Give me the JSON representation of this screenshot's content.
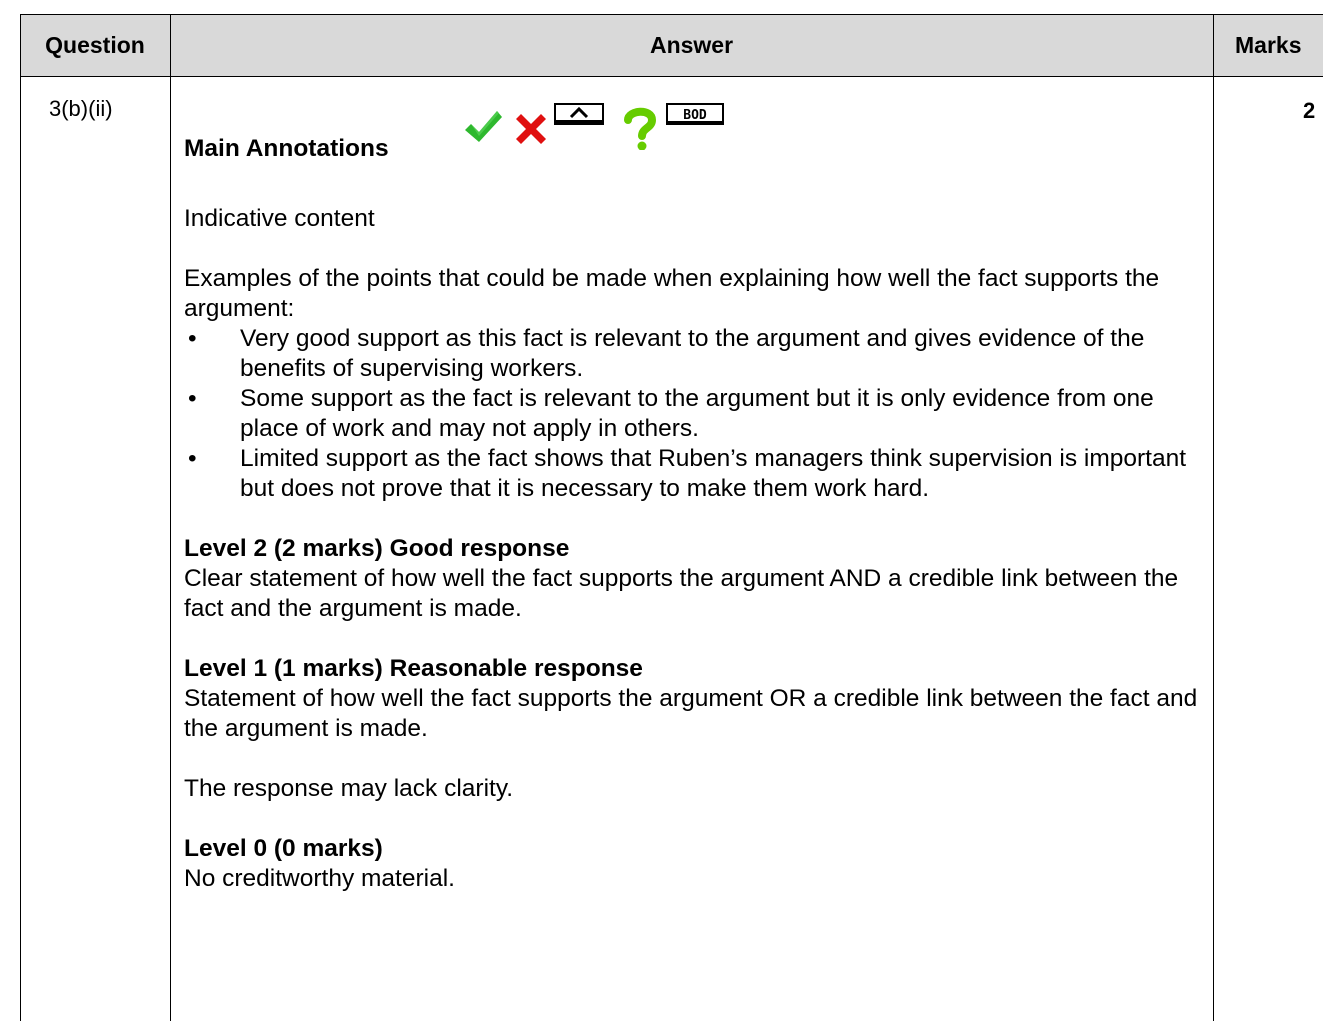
{
  "table": {
    "headers": {
      "question": "Question",
      "answer": "Answer",
      "marks": "Marks"
    },
    "row": {
      "question": "3(b)(ii)",
      "marks": "2"
    }
  },
  "answer": {
    "annotations_label": "Main Annotations",
    "annotation_icons": [
      "tick-icon",
      "cross-icon",
      "caret-icon",
      "question-mark-icon",
      "bod-icon"
    ],
    "annotation_bod_text": "BOD",
    "indicative": "Indicative content",
    "intro": "Examples of the points that could be made when explaining how well the fact supports the argument:",
    "points": [
      "Very good support as this fact is relevant to the argument and gives evidence of the benefits of supervising workers.",
      "Some support as the fact is relevant to the argument but it is only evidence from one place of work and may not apply in others.",
      "Limited support as the fact shows that Ruben’s managers think supervision is important but does not prove that it is necessary to make them work hard."
    ],
    "level2": {
      "heading": "Level 2 (2 marks) Good response",
      "text": "Clear statement of how well the fact supports the argument AND a credible link between the fact and the argument is made."
    },
    "level1": {
      "heading": "Level 1 (1 marks) Reasonable response",
      "text": "Statement of how well the fact supports the argument OR a credible link between the fact and the argument is made.",
      "note": "The response may lack clarity."
    },
    "level0": {
      "heading": "Level 0 (0 marks)",
      "text": "No creditworthy material."
    }
  },
  "colors": {
    "header_bg": "#d9d9d9",
    "tick": "#2eb82e",
    "cross": "#e01010",
    "question_mark": "#66cc00"
  }
}
